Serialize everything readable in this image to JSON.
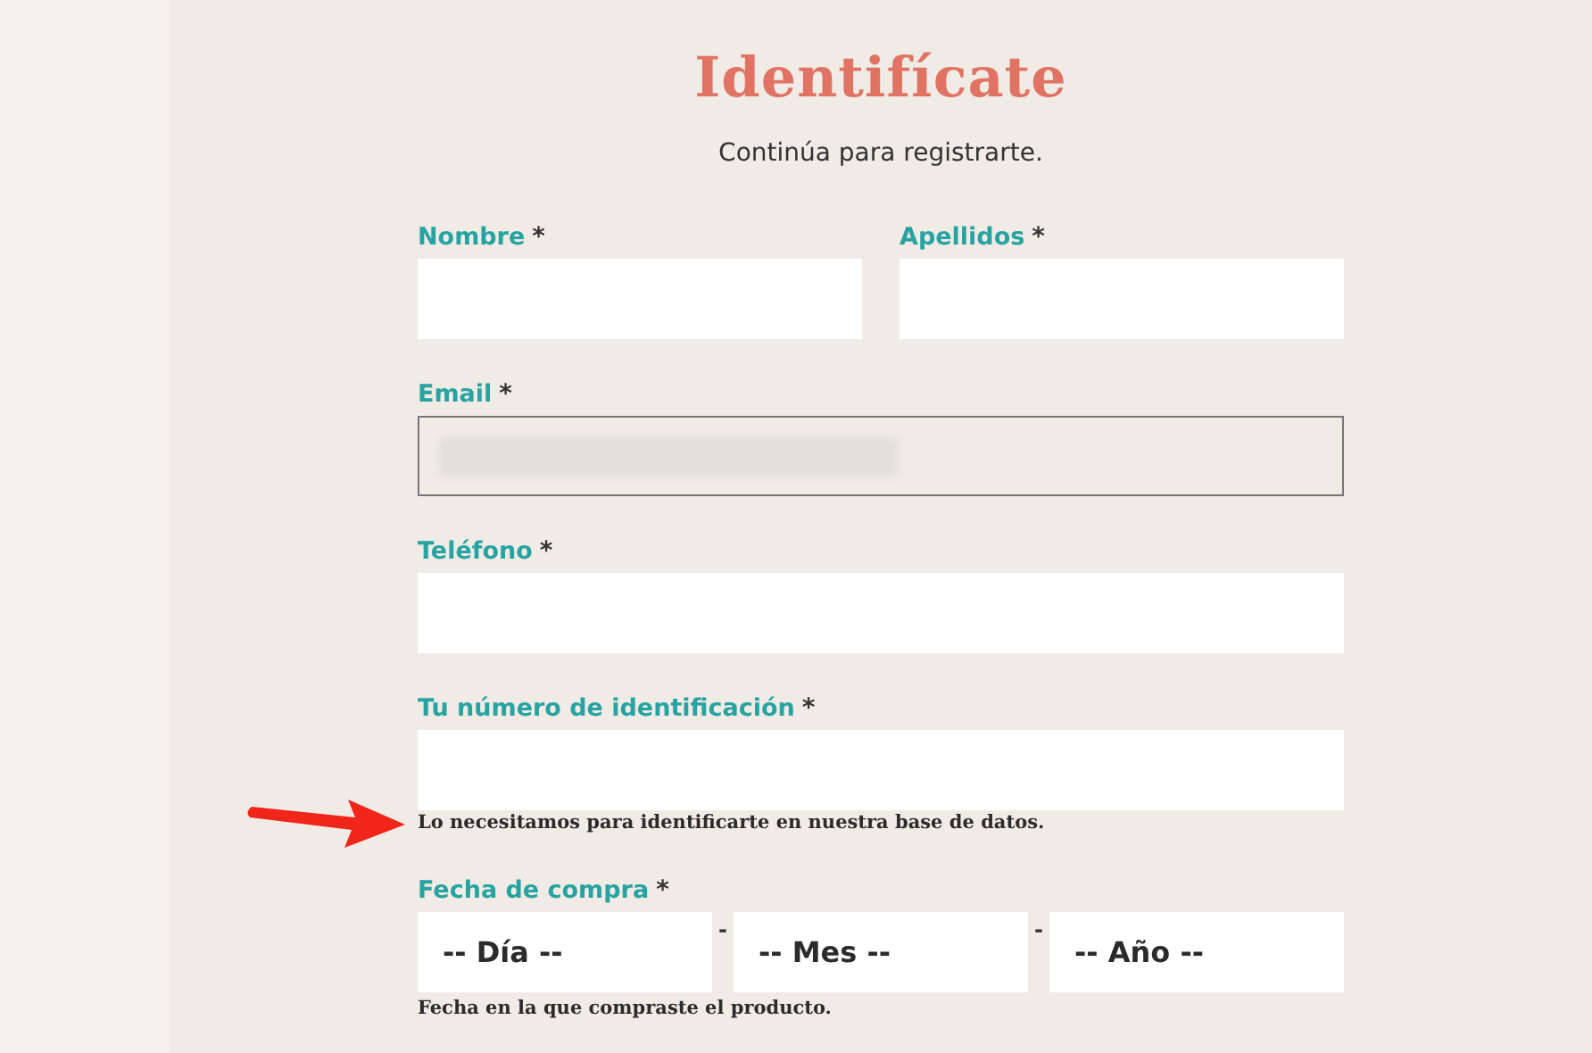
{
  "title": "Identifícate",
  "subtitle": "Continúa para registrarte.",
  "rows": [
    {
      "kind": "text",
      "fields": [
        {
          "label": "Nombre",
          "required": "*",
          "redacted": false
        },
        {
          "label": "Apellidos",
          "required": "*",
          "redacted": false
        }
      ]
    },
    {
      "kind": "text",
      "fields": [
        {
          "label": "Email",
          "required": "*",
          "redacted": true
        }
      ]
    },
    {
      "kind": "text",
      "fields": [
        {
          "label": "Teléfono",
          "required": "*",
          "redacted": false
        }
      ]
    },
    {
      "kind": "text",
      "fields": [
        {
          "label": "Tu número de identificación",
          "required": "*",
          "redacted": false
        }
      ],
      "help": "Lo necesitamos para identificarte en nuestra base de datos.",
      "annotated": true
    },
    {
      "kind": "date",
      "label": "Fecha de compra",
      "required": "*",
      "selects": [
        {
          "value": "-- Día --"
        },
        {
          "value": "-- Mes --"
        },
        {
          "value": "-- Año --"
        }
      ],
      "separators": [
        "-",
        "-"
      ],
      "help": "Fecha en la que compraste el producto."
    }
  ]
}
